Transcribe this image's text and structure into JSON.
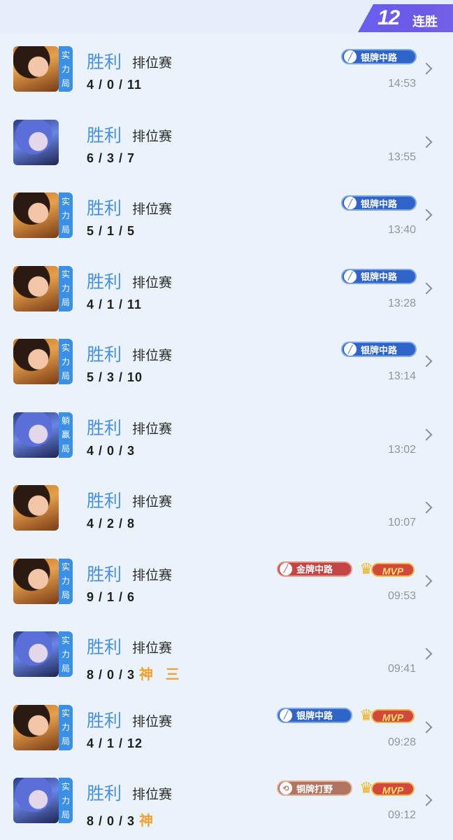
{
  "header": {
    "streak_count": "12",
    "streak_label": "连胜"
  },
  "colors": {
    "result_blue": "#4a90d9",
    "badge_silver_blue": "#2f65c9",
    "badge_gold_red": "#c44545",
    "badge_bronze": "#b07460",
    "mvp_red": "#d2483a",
    "tag_blue": "#3a8fe6",
    "page_bg": "#eaf3fc"
  },
  "matches": [
    {
      "result": "胜利",
      "mode": "排位赛",
      "kda": "4 / 0 / 11",
      "time": "14:53",
      "tag": [
        "实",
        "力",
        "局"
      ],
      "avatar": "hero-warm",
      "badge": {
        "label": "银牌中路",
        "type": "blue",
        "icon": "sword-icon"
      },
      "mvp": false
    },
    {
      "result": "胜利",
      "mode": "排位赛",
      "kda": "6 / 3 / 7",
      "time": "13:55",
      "tag": null,
      "avatar": "hero-cool",
      "badge": null,
      "mvp": false
    },
    {
      "result": "胜利",
      "mode": "排位赛",
      "kda": "5 / 1 / 5",
      "time": "13:40",
      "tag": [
        "实",
        "力",
        "局"
      ],
      "avatar": "hero-warm",
      "badge": {
        "label": "银牌中路",
        "type": "blue",
        "icon": "sword-icon"
      },
      "mvp": false
    },
    {
      "result": "胜利",
      "mode": "排位赛",
      "kda": "4 / 1 / 11",
      "time": "13:28",
      "tag": [
        "实",
        "力",
        "局"
      ],
      "avatar": "hero-warm",
      "badge": {
        "label": "银牌中路",
        "type": "blue",
        "icon": "sword-icon"
      },
      "mvp": false
    },
    {
      "result": "胜利",
      "mode": "排位赛",
      "kda": "5 / 3 / 10",
      "time": "13:14",
      "tag": [
        "实",
        "力",
        "局"
      ],
      "avatar": "hero-warm",
      "badge": {
        "label": "银牌中路",
        "type": "blue",
        "icon": "sword-icon"
      },
      "mvp": false
    },
    {
      "result": "胜利",
      "mode": "排位赛",
      "kda": "4 / 0 / 3",
      "time": "13:02",
      "tag": [
        "躺",
        "赢",
        "局"
      ],
      "avatar": "hero-cool",
      "badge": null,
      "mvp": false
    },
    {
      "result": "胜利",
      "mode": "排位赛",
      "kda": "4 / 2 / 8",
      "time": "10:07",
      "tag": null,
      "avatar": "hero-warm",
      "badge": null,
      "mvp": false
    },
    {
      "result": "胜利",
      "mode": "排位赛",
      "kda": "9 / 1 / 6",
      "time": "09:53",
      "tag": [
        "实",
        "力",
        "局"
      ],
      "avatar": "hero-warm",
      "badge": {
        "label": "金牌中路",
        "type": "red",
        "icon": "sword-icon"
      },
      "mvp": true,
      "mvp_label": "MVP"
    },
    {
      "result": "胜利",
      "mode": "排位赛",
      "kda": "8 / 0 / 3",
      "extra": "神 三",
      "time": "09:41",
      "tag": [
        "实",
        "力",
        "局"
      ],
      "avatar": "hero-cool",
      "badge": null,
      "mvp": false
    },
    {
      "result": "胜利",
      "mode": "排位赛",
      "kda": "4 / 1 / 12",
      "time": "09:28",
      "tag": [
        "实",
        "力",
        "局"
      ],
      "avatar": "hero-warm",
      "badge": {
        "label": "银牌中路",
        "type": "blue",
        "icon": "sword-icon"
      },
      "mvp": true,
      "mvp_label": "MVP"
    },
    {
      "result": "胜利",
      "mode": "排位赛",
      "kda": "8 / 0 / 3",
      "extra": "神",
      "time": "09:12",
      "tag": [
        "实",
        "力",
        "局"
      ],
      "avatar": "hero-cool",
      "badge": {
        "label": "铜牌打野",
        "type": "bronze",
        "icon": "swirl-icon"
      },
      "mvp": true,
      "mvp_label": "MVP"
    }
  ]
}
